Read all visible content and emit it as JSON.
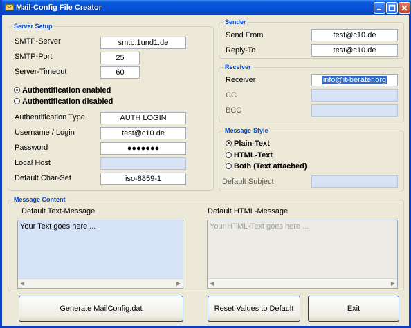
{
  "window": {
    "title": "Mail-Config File Creator"
  },
  "server_setup": {
    "title": "Server Setup",
    "smtp_server": {
      "label": "SMTP-Server",
      "value": "smtp.1und1.de"
    },
    "smtp_port": {
      "label": "SMTP-Port",
      "value": "25"
    },
    "server_timeout": {
      "label": "Server-Timeout",
      "value": "60"
    },
    "auth_enabled": {
      "label": "Authentification enabled",
      "checked": true
    },
    "auth_disabled": {
      "label": "Authentification disabled",
      "checked": false
    },
    "auth_type": {
      "label": "Authentification Type",
      "value": "AUTH LOGIN"
    },
    "username": {
      "label": "Username / Login",
      "value": "test@c10.de"
    },
    "password": {
      "label": "Password",
      "value": "●●●●●●●"
    },
    "local_host": {
      "label": "Local Host",
      "value": ""
    },
    "charset": {
      "label": "Default Char-Set",
      "value": "iso-8859-1"
    }
  },
  "sender": {
    "title": "Sender",
    "send_from": {
      "label": "Send From",
      "value": "test@c10.de"
    },
    "reply_to": {
      "label": "Reply-To",
      "value": "test@c10.de"
    }
  },
  "receiver": {
    "title": "Receiver",
    "receiver": {
      "label": "Receiver",
      "value": "info@it-berater.org"
    },
    "cc": {
      "label": "CC",
      "value": ""
    },
    "bcc": {
      "label": "BCC",
      "value": ""
    }
  },
  "message_style": {
    "title": "Message-Style",
    "plain_text": {
      "label": "Plain-Text",
      "checked": true
    },
    "html_text": {
      "label": "HTML-Text",
      "checked": false
    },
    "both": {
      "label": "Both (Text attached)",
      "checked": false
    },
    "default_subject": {
      "label": "Default Subject",
      "value": ""
    }
  },
  "message_content": {
    "title": "Message Content",
    "text_label": "Default Text-Message",
    "text_value": "Your Text goes here ...",
    "html_label": "Default HTML-Message",
    "html_value": "Your HTML-Text goes here ..."
  },
  "buttons": {
    "generate": "Generate MailConfig.dat",
    "reset": "Reset Values to Default",
    "exit": "Exit"
  },
  "colors": {
    "titlebar": "#0450d8",
    "group_title": "#0046d5",
    "disabled_field": "#d7e3f5",
    "selection": "#316ac5"
  }
}
